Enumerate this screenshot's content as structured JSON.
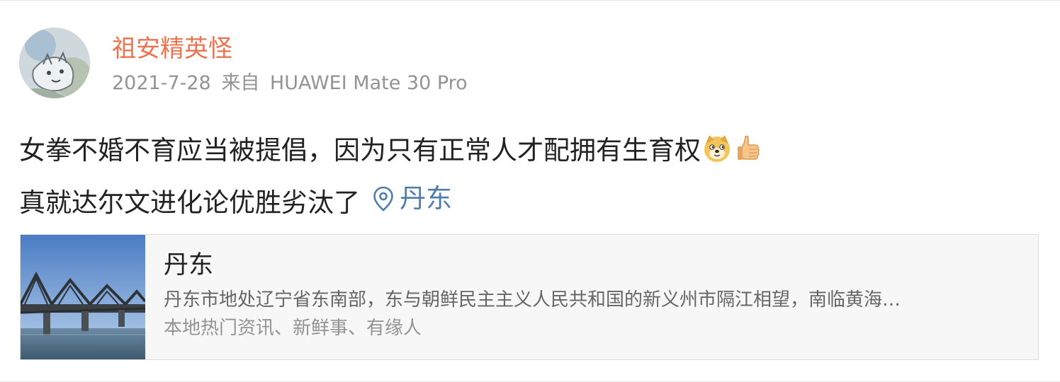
{
  "post": {
    "username": "祖安精英怪",
    "date": "2021-7-28",
    "source_prefix": "来自",
    "device": "HUAWEI Mate 30 Pro",
    "text_line1": "女拳不婚不育应当被提倡，因为只有正常人才配拥有生育权",
    "text_line2": "真就达尔文进化论优胜劣汰了",
    "emojis": [
      "doge-emoji",
      "thumbs-up-emoji"
    ],
    "location": "丹东",
    "colors": {
      "username": "#eb7350",
      "link": "#507daf",
      "meta": "#939393"
    }
  },
  "card": {
    "title": "丹东",
    "description": "丹东市地处辽宁省东南部，东与朝鲜民主主义人民共和国的新义州市隔江相望，南临黄海…",
    "subtitle": "本地热门资讯、新鲜事、有缘人"
  }
}
